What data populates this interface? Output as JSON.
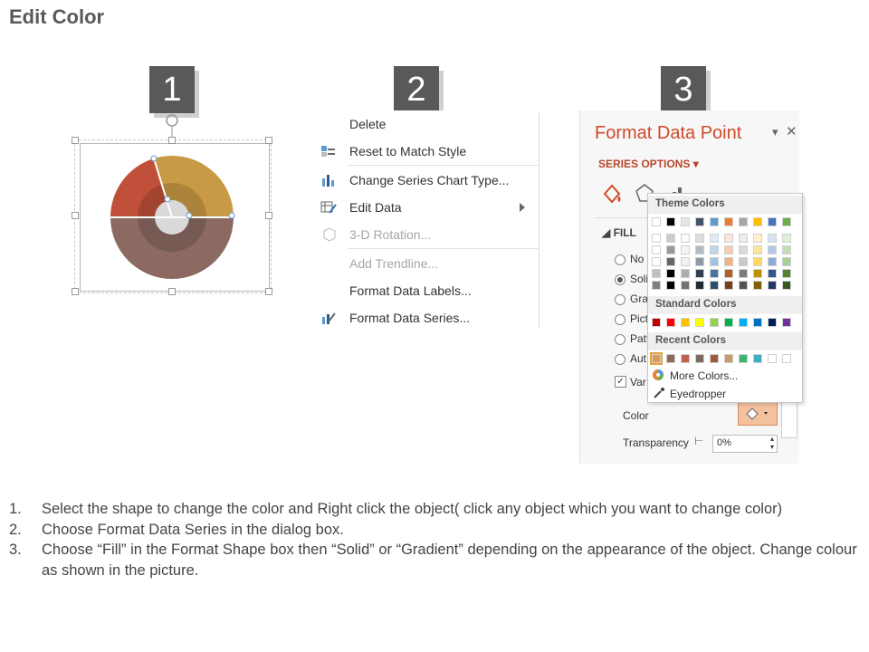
{
  "title": "Edit Color",
  "steps": [
    "1",
    "2",
    "3"
  ],
  "context_menu": {
    "items": [
      {
        "label": "Delete",
        "icon": "none",
        "disabled": false
      },
      {
        "label": "Reset to Match Style",
        "icon": "reset-style-icon",
        "disabled": false
      },
      {
        "label": "Change Series Chart Type...",
        "icon": "bar-chart-icon",
        "disabled": false
      },
      {
        "label": "Edit Data",
        "icon": "edit-data-icon",
        "disabled": false,
        "submenu": true
      },
      {
        "label": "3-D Rotation...",
        "icon": "cube-icon",
        "disabled": true
      },
      {
        "label": "Add Trendline...",
        "icon": "none",
        "disabled": true
      },
      {
        "label": "Format Data Labels...",
        "icon": "none",
        "disabled": false
      },
      {
        "label": "Format Data Series...",
        "icon": "format-series-icon",
        "disabled": false
      }
    ]
  },
  "format_pane": {
    "title": "Format Data Point",
    "series_options": "SERIES OPTIONS",
    "fill_header": "FILL",
    "radio_labels": [
      "No",
      "Soli",
      "Grad",
      "Pict",
      "Patt",
      "Aut"
    ],
    "selected_radio": 1,
    "vary_label": "Var",
    "color_label": "Color",
    "transparency_label": "Transparency",
    "transparency_value": "0%"
  },
  "palette": {
    "theme_header": "Theme Colors",
    "standard_header": "Standard Colors",
    "recent_header": "Recent Colors",
    "more_colors": "More Colors...",
    "eyedropper": "Eyedropper",
    "theme_top": [
      "#ffffff",
      "#000000",
      "#e7e6e6",
      "#44546a",
      "#5b9bd5",
      "#ed7d31",
      "#a5a5a5",
      "#ffc000",
      "#4472c4",
      "#70ad47"
    ],
    "standard": [
      "#c00000",
      "#ff0000",
      "#ffc000",
      "#ffff00",
      "#92d050",
      "#00b050",
      "#00b0f0",
      "#0070c0",
      "#002060",
      "#7030a0"
    ],
    "recent": [
      "#d99a5b",
      "#8c6a5b",
      "#c0604a",
      "#7b6a64",
      "#a05a3c",
      "#c79a6a",
      "#3cb371",
      "#40b0c0",
      "#ffffff",
      "#ffffff"
    ]
  },
  "instructions": [
    {
      "num": "1.",
      "text": "Select the shape to change the color and Right click the object( click any object which you want to change color)"
    },
    {
      "num": "2.",
      "text": "Choose Format Data Series in the dialog box."
    },
    {
      "num": "3.",
      "text": "Choose “Fill” in the Format Shape box then “Solid” or “Gradient” depending on the appearance of the object. Change colour as shown in the picture."
    }
  ]
}
